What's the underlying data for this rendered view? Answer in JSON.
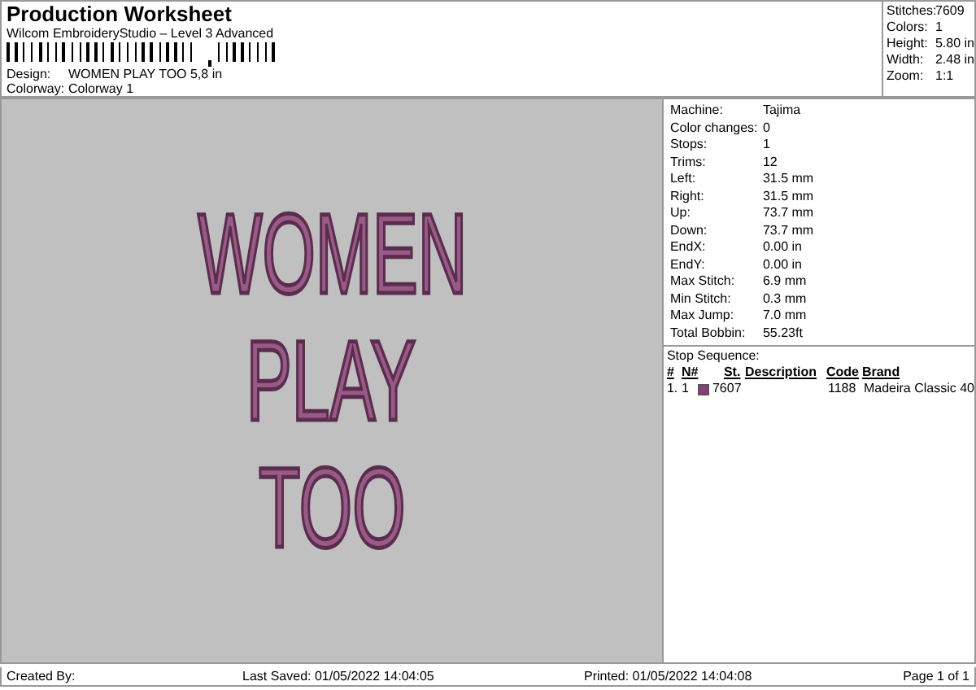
{
  "header": {
    "title": "Production Worksheet",
    "subtitle": "Wilcom EmbroideryStudio – Level 3 Advanced",
    "fields": [
      {
        "label": "Design:",
        "value": "WOMEN PLAY TOO 5,8 in"
      },
      {
        "label": "Colorway:",
        "value": "Colorway 1"
      }
    ]
  },
  "summary": [
    {
      "label": "Stitches:",
      "value": "7609"
    },
    {
      "label": "Colors:",
      "value": "1"
    },
    {
      "label": "Height:",
      "value": "5.80 in"
    },
    {
      "label": "Width:",
      "value": "2.48 in"
    },
    {
      "label": "Zoom:",
      "value": "1:1"
    }
  ],
  "design_preview": {
    "lines": [
      "WOMEN",
      "PLAY",
      "TOO"
    ],
    "color": "#9a5a86"
  },
  "details": [
    {
      "label": "Machine:",
      "value": "Tajima"
    },
    {
      "label": "Color changes:",
      "value": "0"
    },
    {
      "label": "Stops:",
      "value": "1"
    },
    {
      "label": "Trims:",
      "value": "12"
    },
    {
      "label": "Left:",
      "value": "31.5 mm"
    },
    {
      "label": "Right:",
      "value": "31.5 mm"
    },
    {
      "label": "Up:",
      "value": "73.7 mm"
    },
    {
      "label": "Down:",
      "value": "73.7 mm"
    },
    {
      "label": "EndX:",
      "value": "0.00 in"
    },
    {
      "label": "EndY:",
      "value": "0.00 in"
    },
    {
      "label": "Max Stitch:",
      "value": "6.9 mm"
    },
    {
      "label": "Min Stitch:",
      "value": "0.3 mm"
    },
    {
      "label": "Max Jump:",
      "value": "7.0 mm"
    },
    {
      "label": "Total Bobbin:",
      "value": "55.23ft"
    }
  ],
  "stop_sequence": {
    "title": "Stop Sequence:",
    "columns": [
      "#",
      "N#",
      "St.",
      "Description",
      "Code",
      "Brand"
    ],
    "rows": [
      {
        "index": "1.",
        "needle": "1",
        "color": "#8b3f78",
        "stitches": "7607",
        "code": "1188",
        "brand": "Madeira Classic 40"
      }
    ]
  },
  "footer": {
    "created": "Created By:",
    "saved": "Last Saved: 01/05/2022 14:04:05",
    "printed": "Printed: 01/05/2022 14:04:08",
    "page": "Page 1 of 1"
  }
}
